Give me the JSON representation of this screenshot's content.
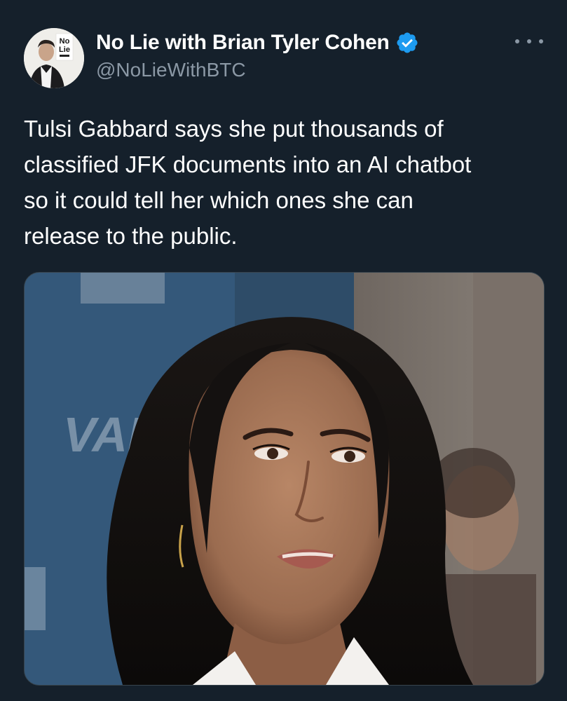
{
  "tweet": {
    "author": {
      "display_name": "No Lie with Brian Tyler Cohen",
      "handle": "@NoLieWithBTC",
      "verified": true,
      "avatar_logo_line1": "No",
      "avatar_logo_line2": "Lie"
    },
    "text": "Tulsi Gabbard says she put thousands of\nclassified JFK documents into an AI chatbot\nso it could tell her which ones she can\nrelease to the public.",
    "more_icon": "more-horizontal-icon",
    "media": {
      "kind": "photo",
      "backdrop_text": "VAN"
    }
  },
  "colors": {
    "background": "#15202b",
    "primary_text": "#ffffff",
    "secondary_text": "#8b98a5",
    "verified_badge": "#1d9bf0",
    "media_border": "#38444d"
  }
}
